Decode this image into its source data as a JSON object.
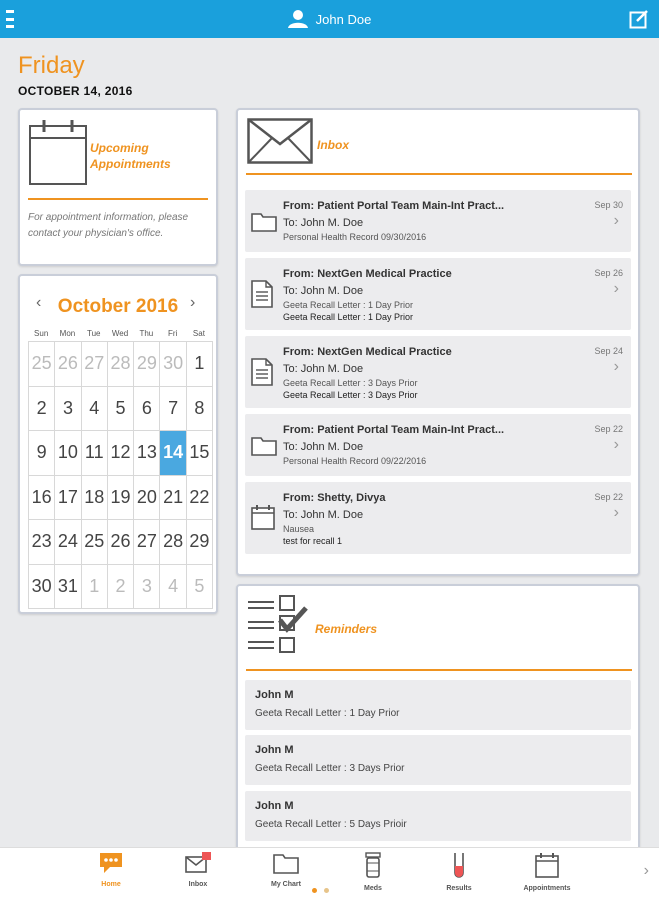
{
  "topbar": {
    "user_name": "John Doe"
  },
  "day": {
    "name": "Friday",
    "date": "OCTOBER 14, 2016"
  },
  "appointments": {
    "title_line1": "Upcoming",
    "title_line2": "Appointments",
    "info": "For appointment information, please contact your physician's office."
  },
  "calendar": {
    "month_label": "October 2016",
    "prev": "‹",
    "next": "›",
    "weekdays": [
      "Sun",
      "Mon",
      "Tue",
      "Wed",
      "Thu",
      "Fri",
      "Sat"
    ],
    "days": [
      "25",
      "26",
      "27",
      "28",
      "29",
      "30",
      "1",
      "2",
      "3",
      "4",
      "5",
      "6",
      "7",
      "8",
      "9",
      "10",
      "11",
      "12",
      "13",
      "14",
      "15",
      "16",
      "17",
      "18",
      "19",
      "20",
      "21",
      "22",
      "23",
      "24",
      "25",
      "26",
      "27",
      "28",
      "29",
      "30",
      "31",
      "1",
      "2",
      "3",
      "4",
      "5"
    ],
    "selected_day": "14"
  },
  "inbox": {
    "title": "Inbox",
    "messages": [
      {
        "icon": "folder-icon",
        "from": "From: Patient Portal Team Main-Int Pract...",
        "to": "To: John M. Doe",
        "sub": "Personal Health Record 09/30/2016",
        "sub2": "",
        "date": "Sep 30"
      },
      {
        "icon": "document-icon",
        "from": "From: NextGen Medical Practice",
        "to": "To: John M. Doe",
        "sub": "Geeta Recall Letter : 1 Day Prior",
        "sub2": "Geeta Recall Letter : 1 Day Prior",
        "date": "Sep 26"
      },
      {
        "icon": "document-icon",
        "from": "From: NextGen Medical Practice",
        "to": "To: John M. Doe",
        "sub": "Geeta Recall Letter : 3 Days Prior",
        "sub2": "Geeta Recall Letter : 3 Days Prior",
        "date": "Sep 24"
      },
      {
        "icon": "folder-icon",
        "from": "From: Patient Portal Team Main-Int Pract...",
        "to": "To: John M. Doe",
        "sub": "Personal Health Record 09/22/2016",
        "sub2": "",
        "date": "Sep 22"
      },
      {
        "icon": "calendar-icon",
        "from": "From: Shetty, Divya",
        "to": "To: John M. Doe",
        "sub": "Nausea",
        "sub2": "test for recall 1",
        "date": "Sep 22"
      }
    ]
  },
  "reminders": {
    "title": "Reminders",
    "items": [
      {
        "who": "John M",
        "what": "Geeta Recall Letter : 1 Day Prior"
      },
      {
        "who": "John M",
        "what": "Geeta Recall Letter : 3 Days Prior"
      },
      {
        "who": "John M",
        "what": "Geeta Recall Letter : 5 Days Prioir"
      }
    ]
  },
  "bottomnav": {
    "items": [
      {
        "label": "Home",
        "icon": "chat-bubble-icon"
      },
      {
        "label": "Inbox",
        "icon": "envelope-icon"
      },
      {
        "label": "My Chart",
        "icon": "folder-icon"
      },
      {
        "label": "Meds",
        "icon": "pill-bottle-icon"
      },
      {
        "label": "Results",
        "icon": "test-tube-icon"
      },
      {
        "label": "Appointments",
        "icon": "calendar-icon"
      }
    ],
    "active": "Home"
  },
  "colors": {
    "brand_blue": "#1aa0dc",
    "accent_orange": "#ef9320",
    "today_blue": "#4aa8e0"
  }
}
